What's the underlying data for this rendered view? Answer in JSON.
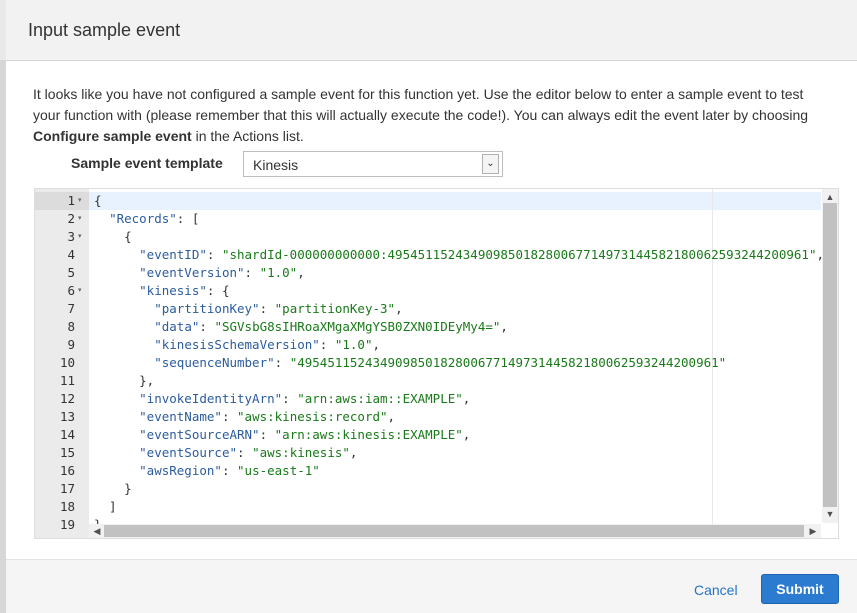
{
  "dialog": {
    "title": "Input sample event",
    "intro_text_1": "It looks like you have not configured a sample event for this function yet. Use the editor below to enter a sample event to test your function with (please remember that this will actually execute the code!). You can always edit the event later by choosing ",
    "intro_bold": "Configure sample event",
    "intro_text_2": " in the Actions list.",
    "template_label": "Sample event template",
    "template_selected": "Kinesis",
    "cancel_label": "Cancel",
    "submit_label": "Submit"
  },
  "editor": {
    "lines": [
      {
        "n": "1",
        "fold": true,
        "segs": [
          {
            "t": "{",
            "c": "p"
          }
        ]
      },
      {
        "n": "2",
        "fold": true,
        "segs": [
          {
            "t": "  ",
            "c": "p"
          },
          {
            "t": "\"Records\"",
            "c": "k"
          },
          {
            "t": ": [",
            "c": "p"
          }
        ]
      },
      {
        "n": "3",
        "fold": true,
        "segs": [
          {
            "t": "    {",
            "c": "p"
          }
        ]
      },
      {
        "n": "4",
        "fold": false,
        "segs": [
          {
            "t": "      ",
            "c": "p"
          },
          {
            "t": "\"eventID\"",
            "c": "k"
          },
          {
            "t": ": ",
            "c": "p"
          },
          {
            "t": "\"shardId-000000000000:49545115243490985018280067714973144582180062593244200961\"",
            "c": "s"
          },
          {
            "t": ",",
            "c": "p"
          }
        ]
      },
      {
        "n": "5",
        "fold": false,
        "segs": [
          {
            "t": "      ",
            "c": "p"
          },
          {
            "t": "\"eventVersion\"",
            "c": "k"
          },
          {
            "t": ": ",
            "c": "p"
          },
          {
            "t": "\"1.0\"",
            "c": "s"
          },
          {
            "t": ",",
            "c": "p"
          }
        ]
      },
      {
        "n": "6",
        "fold": true,
        "segs": [
          {
            "t": "      ",
            "c": "p"
          },
          {
            "t": "\"kinesis\"",
            "c": "k"
          },
          {
            "t": ": {",
            "c": "p"
          }
        ]
      },
      {
        "n": "7",
        "fold": false,
        "segs": [
          {
            "t": "        ",
            "c": "p"
          },
          {
            "t": "\"partitionKey\"",
            "c": "k"
          },
          {
            "t": ": ",
            "c": "p"
          },
          {
            "t": "\"partitionKey-3\"",
            "c": "s"
          },
          {
            "t": ",",
            "c": "p"
          }
        ]
      },
      {
        "n": "8",
        "fold": false,
        "segs": [
          {
            "t": "        ",
            "c": "p"
          },
          {
            "t": "\"data\"",
            "c": "k"
          },
          {
            "t": ": ",
            "c": "p"
          },
          {
            "t": "\"SGVsbG8sIHRoaXMgaXMgYSB0ZXN0IDEyMy4=\"",
            "c": "s"
          },
          {
            "t": ",",
            "c": "p"
          }
        ]
      },
      {
        "n": "9",
        "fold": false,
        "segs": [
          {
            "t": "        ",
            "c": "p"
          },
          {
            "t": "\"kinesisSchemaVersion\"",
            "c": "k"
          },
          {
            "t": ": ",
            "c": "p"
          },
          {
            "t": "\"1.0\"",
            "c": "s"
          },
          {
            "t": ",",
            "c": "p"
          }
        ]
      },
      {
        "n": "10",
        "fold": false,
        "segs": [
          {
            "t": "        ",
            "c": "p"
          },
          {
            "t": "\"sequenceNumber\"",
            "c": "k"
          },
          {
            "t": ": ",
            "c": "p"
          },
          {
            "t": "\"49545115243490985018280067714973144582180062593244200961\"",
            "c": "s"
          }
        ]
      },
      {
        "n": "11",
        "fold": false,
        "segs": [
          {
            "t": "      },",
            "c": "p"
          }
        ]
      },
      {
        "n": "12",
        "fold": false,
        "segs": [
          {
            "t": "      ",
            "c": "p"
          },
          {
            "t": "\"invokeIdentityArn\"",
            "c": "k"
          },
          {
            "t": ": ",
            "c": "p"
          },
          {
            "t": "\"arn:aws:iam::EXAMPLE\"",
            "c": "s"
          },
          {
            "t": ",",
            "c": "p"
          }
        ]
      },
      {
        "n": "13",
        "fold": false,
        "segs": [
          {
            "t": "      ",
            "c": "p"
          },
          {
            "t": "\"eventName\"",
            "c": "k"
          },
          {
            "t": ": ",
            "c": "p"
          },
          {
            "t": "\"aws:kinesis:record\"",
            "c": "s"
          },
          {
            "t": ",",
            "c": "p"
          }
        ]
      },
      {
        "n": "14",
        "fold": false,
        "segs": [
          {
            "t": "      ",
            "c": "p"
          },
          {
            "t": "\"eventSourceARN\"",
            "c": "k"
          },
          {
            "t": ": ",
            "c": "p"
          },
          {
            "t": "\"arn:aws:kinesis:EXAMPLE\"",
            "c": "s"
          },
          {
            "t": ",",
            "c": "p"
          }
        ]
      },
      {
        "n": "15",
        "fold": false,
        "segs": [
          {
            "t": "      ",
            "c": "p"
          },
          {
            "t": "\"eventSource\"",
            "c": "k"
          },
          {
            "t": ": ",
            "c": "p"
          },
          {
            "t": "\"aws:kinesis\"",
            "c": "s"
          },
          {
            "t": ",",
            "c": "p"
          }
        ]
      },
      {
        "n": "16",
        "fold": false,
        "segs": [
          {
            "t": "      ",
            "c": "p"
          },
          {
            "t": "\"awsRegion\"",
            "c": "k"
          },
          {
            "t": ": ",
            "c": "p"
          },
          {
            "t": "\"us-east-1\"",
            "c": "s"
          }
        ]
      },
      {
        "n": "17",
        "fold": false,
        "segs": [
          {
            "t": "    }",
            "c": "p"
          }
        ]
      },
      {
        "n": "18",
        "fold": false,
        "segs": [
          {
            "t": "  ]",
            "c": "p"
          }
        ]
      },
      {
        "n": "19",
        "fold": false,
        "segs": [
          {
            "t": "}",
            "c": "p"
          }
        ]
      }
    ]
  },
  "icons": {
    "select_arrow": "chevron-down-icon",
    "fold": "fold-arrow-icon",
    "scroll_up": "scroll-up-arrow-icon",
    "scroll_down": "scroll-down-arrow-icon",
    "scroll_left": "scroll-left-arrow-icon",
    "scroll_right": "scroll-right-arrow-icon"
  },
  "colors": {
    "submit": "#2b7bd1",
    "link": "#2574c5",
    "json_key": "#2c5c9e",
    "json_string": "#1a7a1a"
  }
}
